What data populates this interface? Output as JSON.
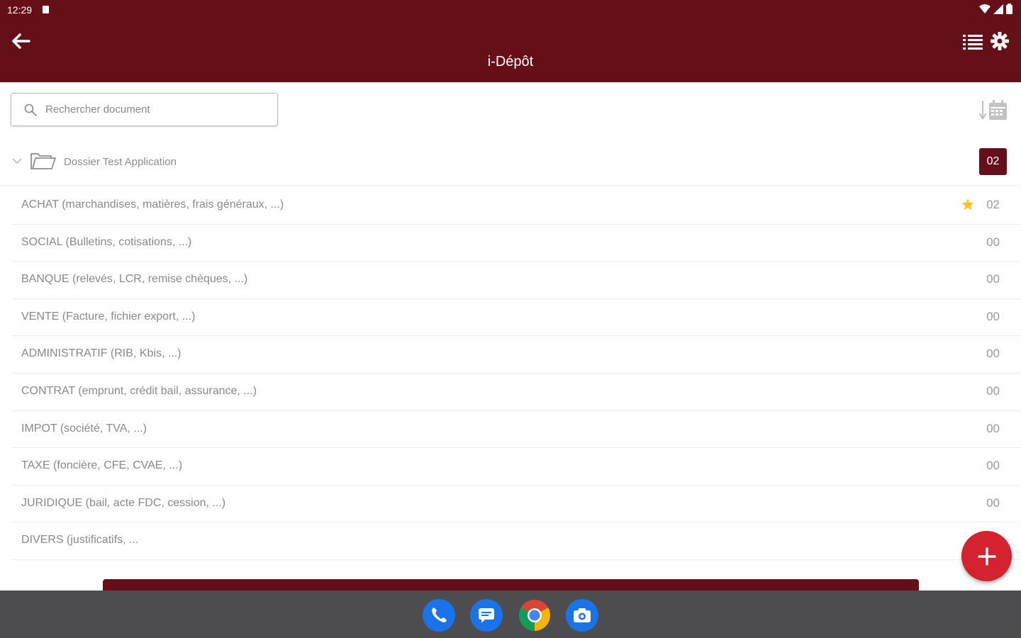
{
  "status_bar": {
    "time": "12:29"
  },
  "app_bar": {
    "title": "i-Dépôt"
  },
  "search": {
    "placeholder": "Rechercher document"
  },
  "folder": {
    "label": "Dossier Test Application",
    "count": "02"
  },
  "categories": [
    {
      "label": "ACHAT (marchandises, matières, frais généraux, ...)",
      "count": "02",
      "starred": true
    },
    {
      "label": "SOCIAL (Bulletins, cotisations, ...)",
      "count": "00"
    },
    {
      "label": "BANQUE (relevés, LCR, remise chèques, ...)",
      "count": "00"
    },
    {
      "label": "VENTE (Facture, fichier export, ...)",
      "count": "00"
    },
    {
      "label": "ADMINISTRATIF (RIB, Kbis, ...)",
      "count": "00"
    },
    {
      "label": "CONTRAT (emprunt, crédit bail, assurance, ...)",
      "count": "00"
    },
    {
      "label": "IMPOT (société, TVA, ...)",
      "count": "00"
    },
    {
      "label": "TAXE (foncière, CFE, CVAE, ...)",
      "count": "00"
    },
    {
      "label": "JURIDIQUE (bail, acte FDC, cession, ...)",
      "count": "00"
    },
    {
      "label": "DIVERS (justificatifs, ...",
      "count": ""
    }
  ],
  "colors": {
    "primary": "#650f18",
    "fab": "#d4222e",
    "star": "#f5c518",
    "dock": "#4d4d4f"
  },
  "icons": [
    "back-arrow-icon",
    "list-view-icon",
    "gear-icon",
    "search-icon",
    "sort-calendar-icon",
    "chevron-down-icon",
    "folder-open-icon",
    "star-icon",
    "plus-icon",
    "phone-icon",
    "messages-icon",
    "chrome-icon",
    "camera-icon"
  ]
}
